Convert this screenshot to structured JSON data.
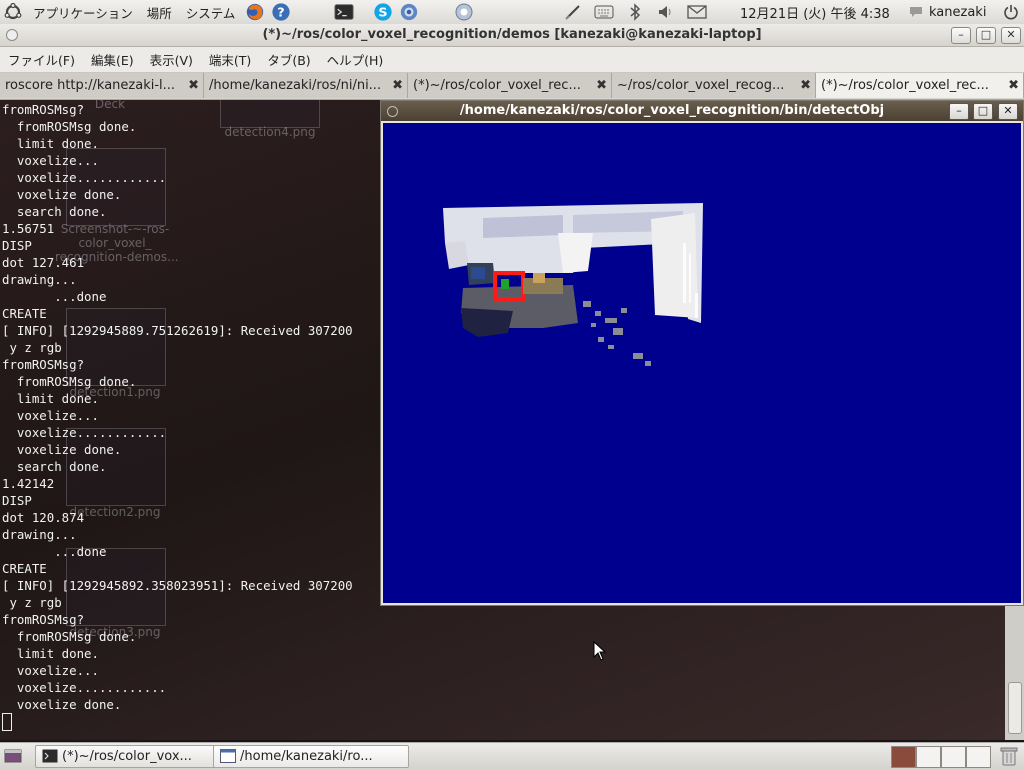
{
  "top_panel": {
    "menus": [
      "アプリケーション",
      "場所",
      "システム"
    ],
    "clock": "12月21日 (火) 午後 4:38",
    "user": "kanezaki"
  },
  "terminal_window": {
    "title": "(*)~/ros/color_voxel_recognition/demos [kanezaki@kanezaki-laptop]",
    "menus": [
      "ファイル(F)",
      "編集(E)",
      "表示(V)",
      "端末(T)",
      "タブ(B)",
      "ヘルプ(H)"
    ],
    "tabs": [
      "roscore http://kanezaki-l...",
      "/home/kanezaki/ros/ni/ni...",
      "(*)~/ros/color_voxel_rec...",
      "~/ros/color_voxel_recog...",
      "(*)~/ros/color_voxel_rec..."
    ],
    "lines": [
      "fromROSMsg?",
      "  fromROSMsg done.",
      "  limit done.",
      "  voxelize...",
      "  voxelize............",
      "  voxelize done.",
      "  search done.",
      "1.56751",
      "DISP",
      "dot 127.461",
      "drawing...",
      "       ...done",
      "CREATE",
      "[ INFO] [1292945889.751262619]: Received 307200",
      " y z rgb",
      "fromROSMsg?",
      "  fromROSMsg done.",
      "  limit done.",
      "  voxelize...",
      "  voxelize............",
      "  voxelize done.",
      "  search done.",
      "1.42142",
      "DISP",
      "dot 120.874",
      "drawing...",
      "       ...done",
      "CREATE",
      "[ INFO] [1292945892.358023951]: Received 307200",
      " y z rgb",
      "fromROSMsg?",
      "  fromROSMsg done.",
      "  limit done.",
      "  voxelize...",
      "  voxelize............",
      "  voxelize done."
    ]
  },
  "desktop_icons": [
    {
      "label": "Deck"
    },
    {
      "label": "detection4.png"
    },
    {
      "label": "Screenshot-~-ros-\ncolor_voxel_\nrecognition-demos..."
    },
    {
      "label": "detection1.png"
    },
    {
      "label": "detection2.png"
    },
    {
      "label": "detection3.png"
    }
  ],
  "viewer_window": {
    "title": "/home/kanezaki/ros/color_voxel_recognition/bin/detectObj",
    "background_color": "#00008f"
  },
  "taskbar": {
    "items": [
      "(*)~/ros/color_vox...",
      "/home/kanezaki/ro..."
    ]
  }
}
